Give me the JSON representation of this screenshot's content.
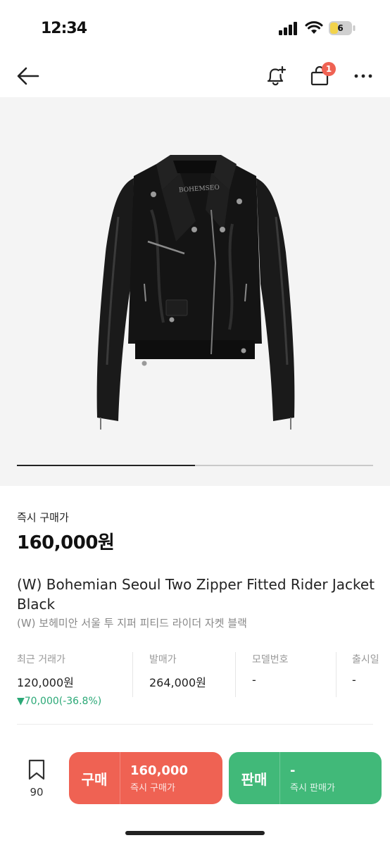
{
  "status": {
    "time": "12:34",
    "battery": "6"
  },
  "header": {
    "back_icon": "arrow-left-icon",
    "alert_icon": "bell-plus-icon",
    "cart_icon": "shopping-bag-icon",
    "cart_badge": "1",
    "more_icon": "more-horizontal-icon"
  },
  "product_image": {
    "brand_label": "BOHEMSEO",
    "carousel_progress": 0.5
  },
  "price": {
    "label": "즉시 구매가",
    "value": "160,000원"
  },
  "title": {
    "en": "(W) Bohemian Seoul Two Zipper Fitted Rider Jacket Black",
    "ko": "(W) 보헤미안 서울 투 지퍼 피티드 라이더 자켓 블랙"
  },
  "info": {
    "recent": {
      "label": "최근 거래가",
      "value": "120,000원",
      "change": "▼70,000(-36.8%)"
    },
    "release_price": {
      "label": "발매가",
      "value": "264,000원"
    },
    "model": {
      "label": "모델번호",
      "value": "-"
    },
    "release_date": {
      "label": "출시일",
      "value": "-"
    }
  },
  "bottom": {
    "wishlist_count": "90",
    "buy": {
      "tag": "구매",
      "amount": "160,000",
      "sub": "즉시 구매가"
    },
    "sell": {
      "tag": "판매",
      "amount": "-",
      "sub": "즉시 판매가"
    }
  },
  "colors": {
    "buy": "#ef6253",
    "sell": "#41b979",
    "change_down": "#2aa876"
  }
}
